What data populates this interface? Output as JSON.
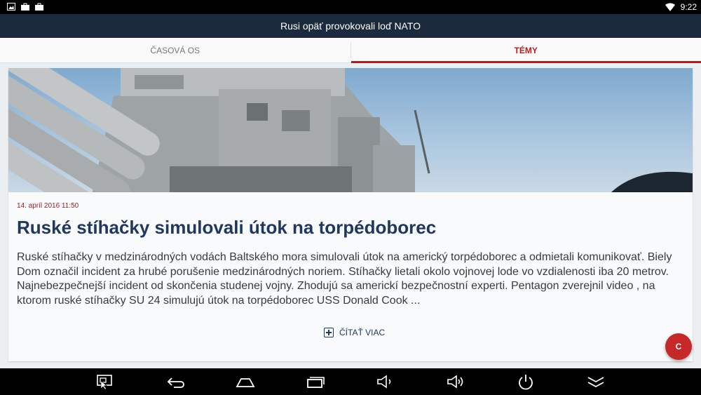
{
  "status_bar": {
    "time": "9:22"
  },
  "app": {
    "title": "Rusi opäť provokovali loď NATO"
  },
  "tabs": [
    {
      "label": "ČASOVÁ OS",
      "active": false
    },
    {
      "label": "TÉMY",
      "active": true
    }
  ],
  "article": {
    "date": "14. apríl 2016 11:50",
    "headline": "Ruské stíhačky simulovali útok na torpédoborec",
    "body": "Ruské stíhačky v medzinárodných vodách Baltského mora simulovali útok na americký torpédoborec a odmietali komunikovať. Biely Dom označil incident za hrubé porušenie medzinárodných noriem. Stíhačky lietali okolo vojnovej lode vo vzdialenosti iba 20 metrov. Najnebezpečnejší incident od skončenia studenej vojny. Zhodujú sa americkí bezpečnostní experti. Pentagon zverejnil video , na ktorom ruské stíhačky SU 24 simulujú útok na torpédoborec USS Donald Cook ...",
    "read_more": "ČÍTAŤ VIAC",
    "hero_image": "warship-missile-launcher-photo"
  },
  "fab": {
    "label": "C"
  },
  "colors": {
    "accent": "#b71c1c",
    "titlebar": "#1b2a3c",
    "headline": "#21385e"
  },
  "nav_icons": [
    "screenshot-icon",
    "back-icon",
    "home-icon",
    "recents-icon",
    "volume-down-icon",
    "volume-up-icon",
    "power-icon",
    "hide-nav-icon"
  ]
}
